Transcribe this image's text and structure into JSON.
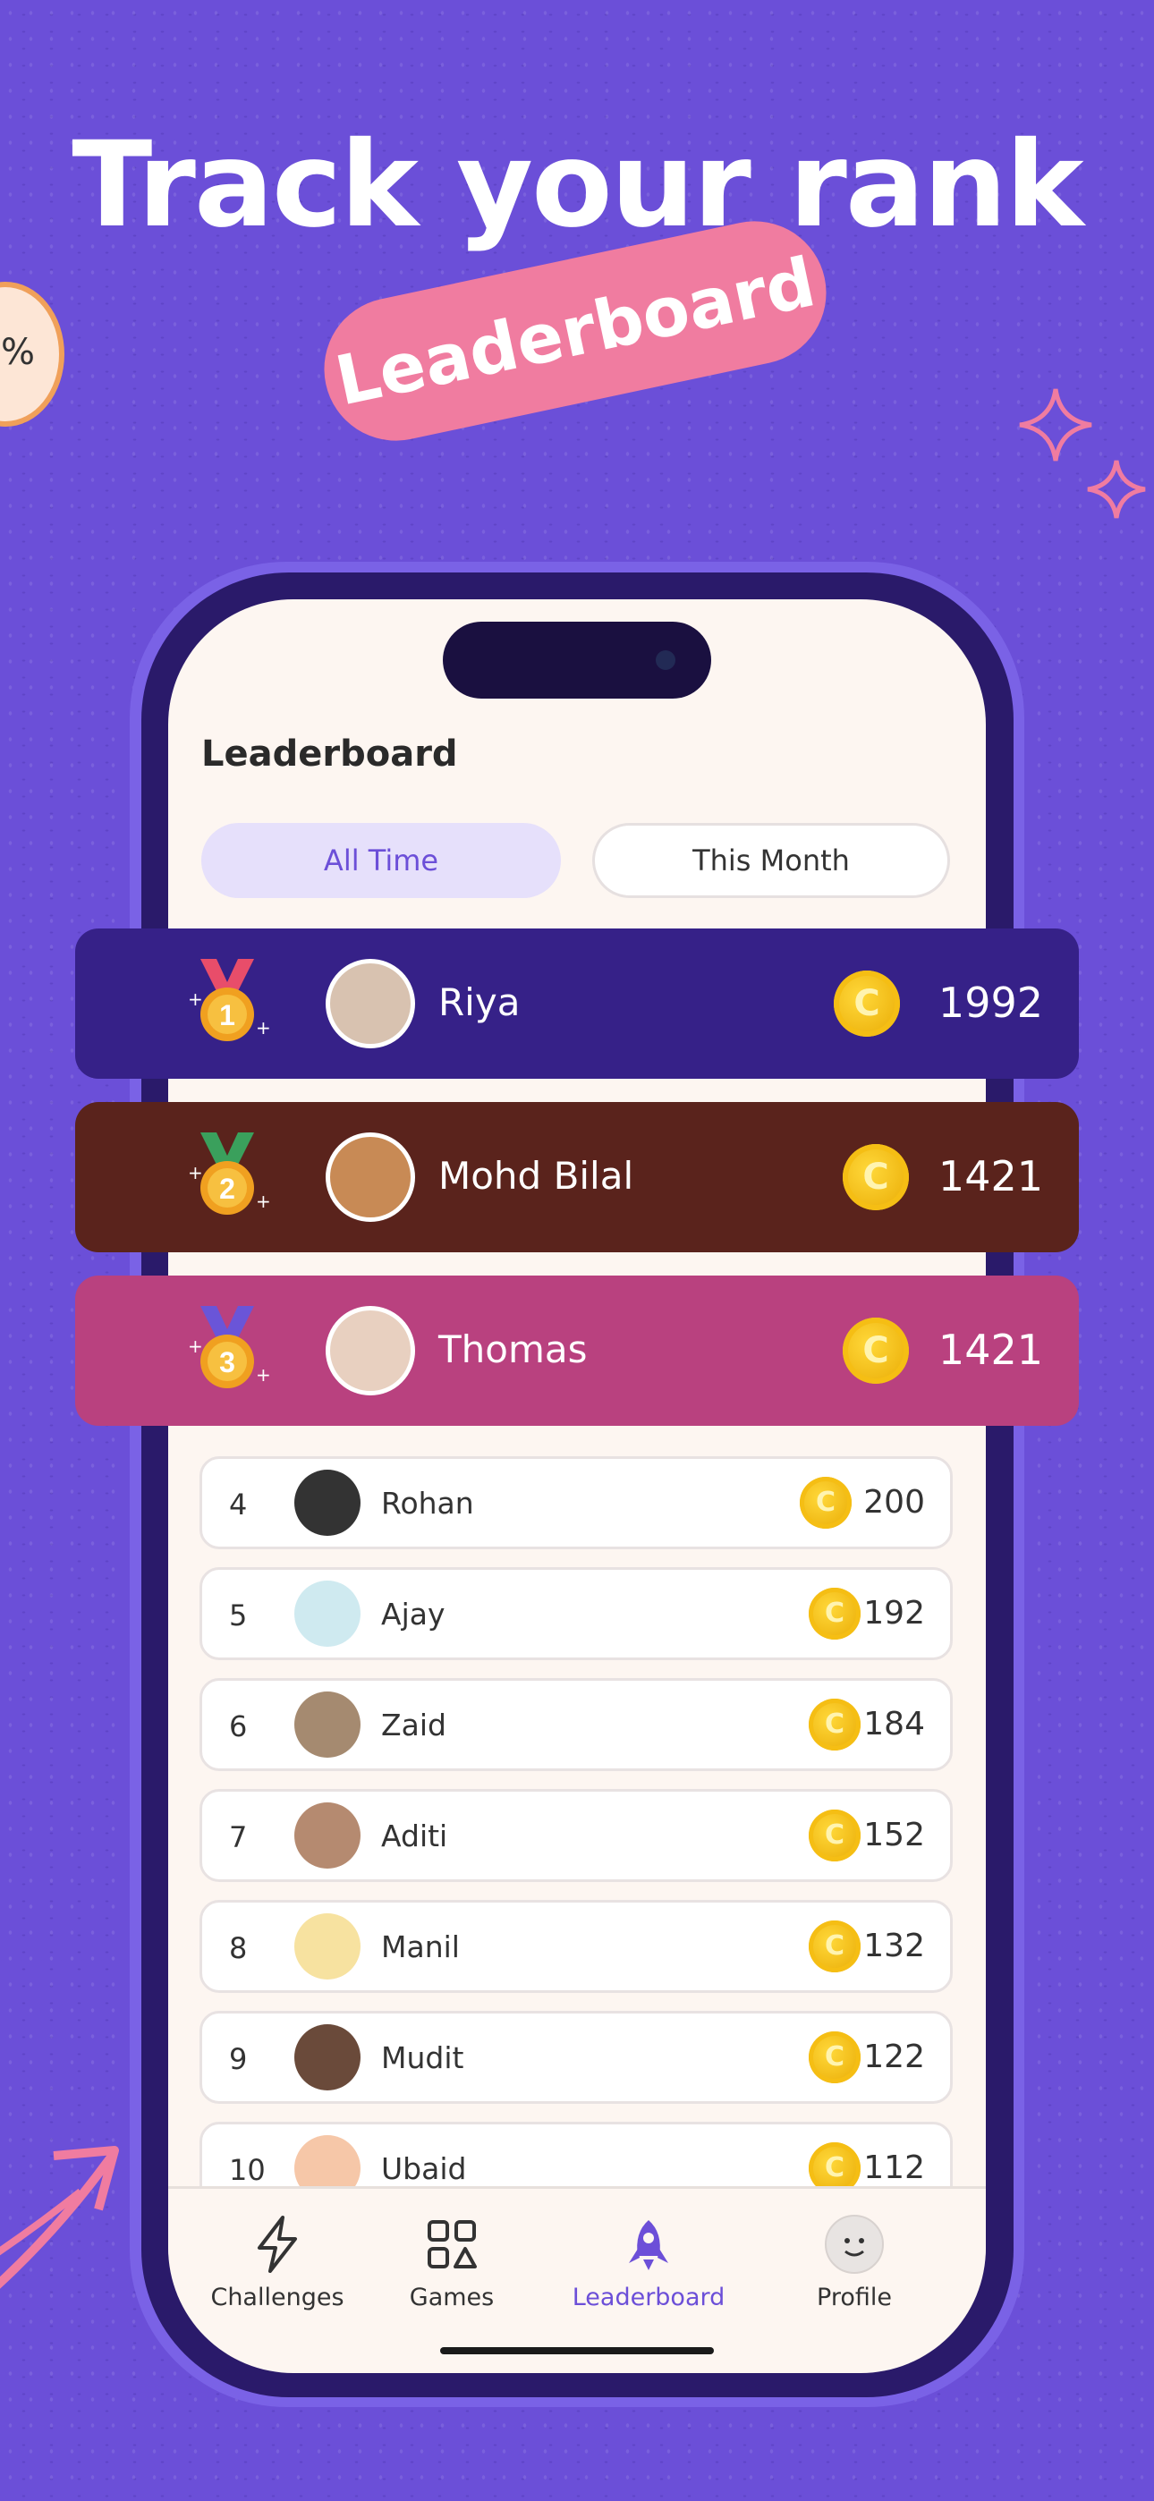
{
  "headline": "Track your rank on",
  "highlight": "Leaderboard",
  "screen_title": "Leaderboard",
  "tabs": {
    "all_time": "All Time",
    "this_month": "This Month"
  },
  "top3": [
    {
      "rank": "1",
      "name": "Riya",
      "score": "1992",
      "bg": "#362188",
      "medal": "#e84d6a"
    },
    {
      "rank": "2",
      "name": "Mohd Bilal",
      "score": "1421",
      "bg": "#5a231c",
      "medal": "#3aa05c"
    },
    {
      "rank": "3",
      "name": "Thomas",
      "score": "1421",
      "bg": "#b9417f",
      "medal": "#6a55d8"
    }
  ],
  "rows": [
    {
      "rank": "4",
      "name": "Rohan",
      "score": "200"
    },
    {
      "rank": "5",
      "name": "Ajay",
      "score": "192"
    },
    {
      "rank": "6",
      "name": "Zaid",
      "score": "184"
    },
    {
      "rank": "7",
      "name": "Aditi",
      "score": "152"
    },
    {
      "rank": "8",
      "name": "Manil",
      "score": "132"
    },
    {
      "rank": "9",
      "name": "Mudit",
      "score": "122"
    },
    {
      "rank": "10",
      "name": "Ubaid",
      "score": "112"
    }
  ],
  "nav": {
    "challenges": "Challenges",
    "games": "Games",
    "leaderboard": "Leaderboard",
    "profile": "Profile"
  },
  "coin_symbol": "C",
  "colors": {
    "accent": "#6c4fd8",
    "background": "#6b4fd8",
    "pink": "#f07ca0"
  }
}
